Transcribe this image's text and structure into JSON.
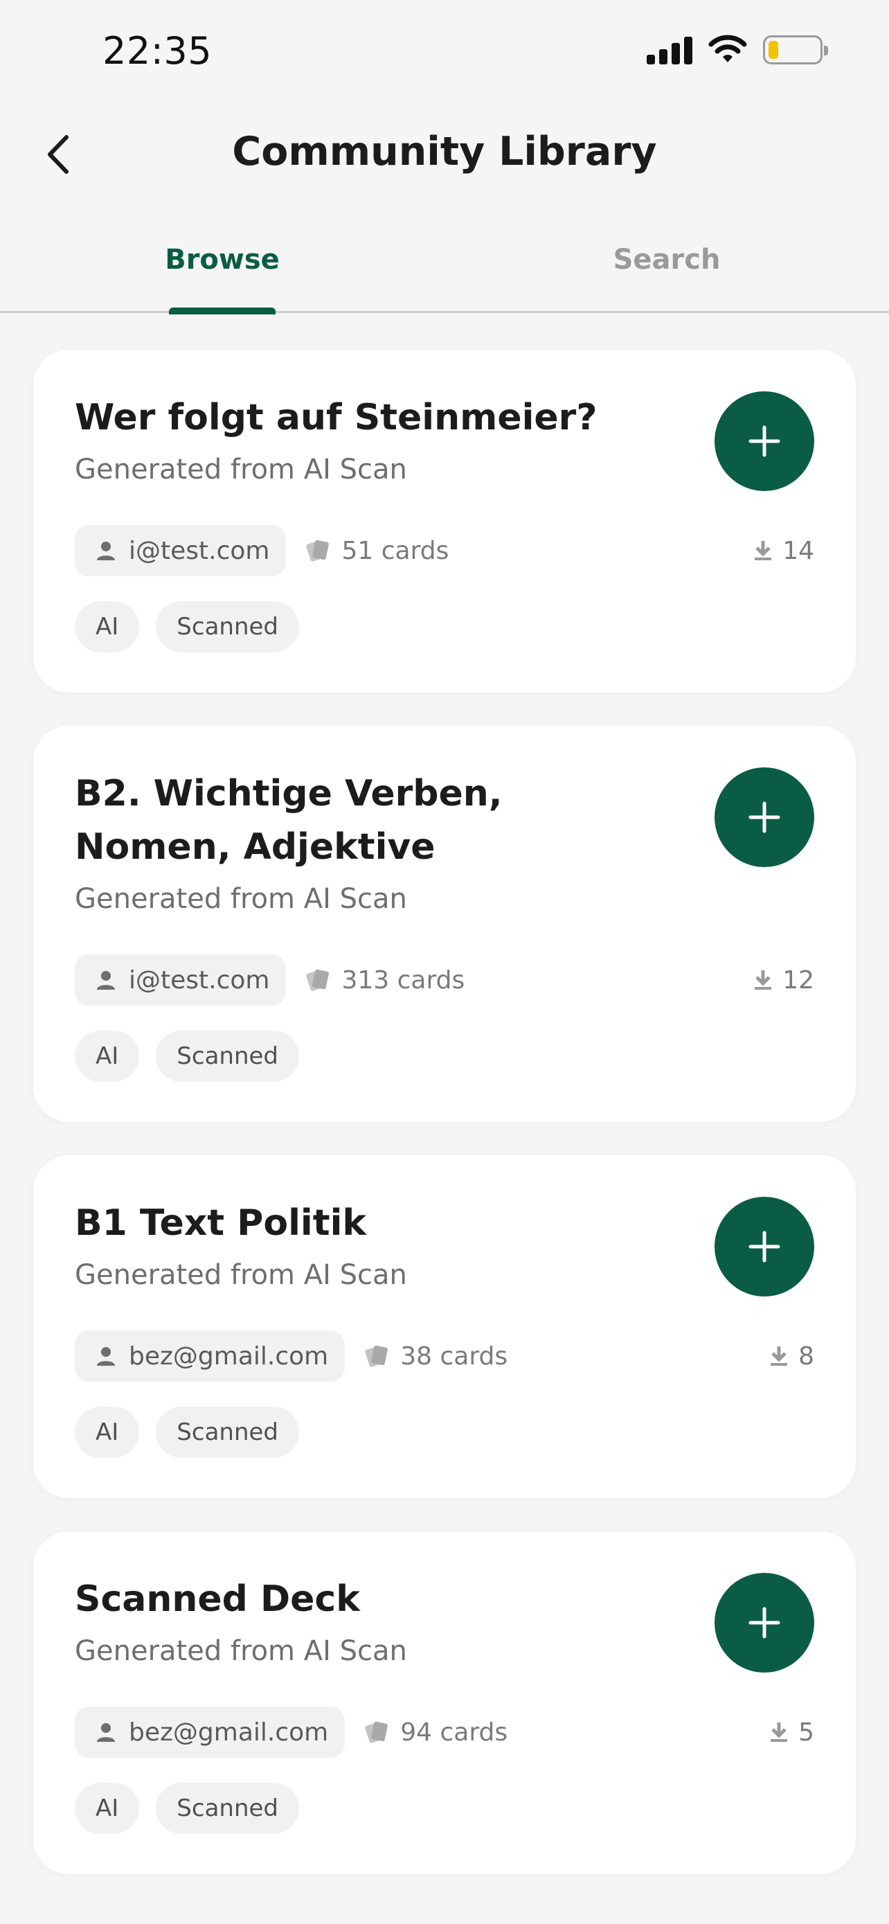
{
  "status_bar": {
    "time": "22:35"
  },
  "header": {
    "title": "Community Library"
  },
  "tabs": [
    {
      "label": "Browse",
      "active": true
    },
    {
      "label": "Search",
      "active": false
    }
  ],
  "colors": {
    "accent": "#0b5c44",
    "background": "#f4f5f4",
    "card": "#ffffff"
  },
  "icons": [
    "back-chevron-icon",
    "signal-icon",
    "wifi-icon",
    "battery-icon",
    "plus-icon",
    "user-icon",
    "cards-icon",
    "download-icon"
  ],
  "decks": [
    {
      "title": "Wer folgt auf Steinmeier?",
      "subtitle": "Generated from AI Scan",
      "author": "i@test.com",
      "cards": "51 cards",
      "downloads": "14",
      "tags": [
        "AI",
        "Scanned"
      ]
    },
    {
      "title": "B2. Wichtige Verben, Nomen, Adjektive",
      "subtitle": "Generated from AI Scan",
      "author": "i@test.com",
      "cards": "313 cards",
      "downloads": "12",
      "tags": [
        "AI",
        "Scanned"
      ]
    },
    {
      "title": "B1 Text Politik",
      "subtitle": "Generated from AI Scan",
      "author": "bez@gmail.com",
      "cards": "38 cards",
      "downloads": "8",
      "tags": [
        "AI",
        "Scanned"
      ]
    },
    {
      "title": "Scanned Deck",
      "subtitle": "Generated from AI Scan",
      "author": "bez@gmail.com",
      "cards": "94 cards",
      "downloads": "5",
      "tags": [
        "AI",
        "Scanned"
      ]
    }
  ]
}
